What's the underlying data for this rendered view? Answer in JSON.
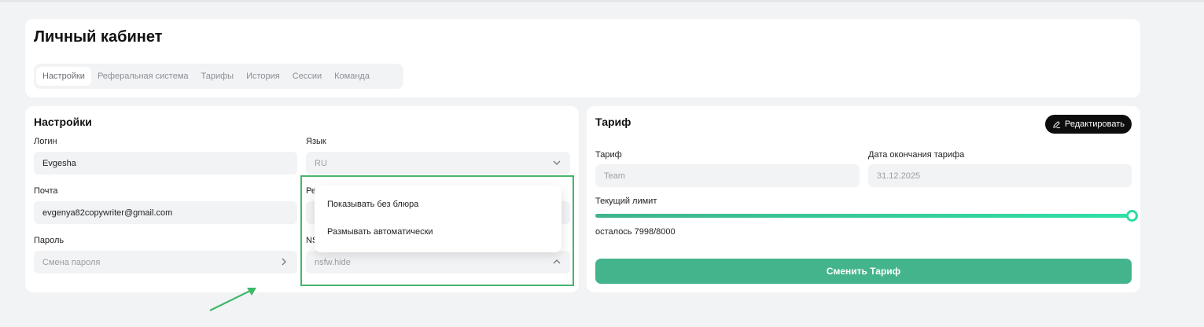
{
  "page": {
    "title": "Личный кабинет",
    "tabs": [
      {
        "label": "Настройки",
        "active": true
      },
      {
        "label": "Реферальная система",
        "active": false
      },
      {
        "label": "Тарифы",
        "active": false
      },
      {
        "label": "История",
        "active": false
      },
      {
        "label": "Сессии",
        "active": false
      },
      {
        "label": "Команда",
        "active": false
      }
    ]
  },
  "settings": {
    "title": "Настройки",
    "login": {
      "label": "Логин",
      "value": "Evgesha"
    },
    "language": {
      "label": "Язык",
      "value": "RU"
    },
    "email": {
      "label": "Почта",
      "value": "evgenya82copywriter@gmail.com"
    },
    "password": {
      "label": "Пароль",
      "placeholder": "Смена пароля"
    },
    "partial_label_1": "Ре",
    "partial_label_2": "NS",
    "nsfw": {
      "value": "nsfw.hide"
    },
    "dropdown_options": [
      "Показывать без блюра",
      "Размывать автоматически"
    ]
  },
  "tariff": {
    "title": "Тариф",
    "edit_label": "Редактировать",
    "plan": {
      "label": "Тариф",
      "value": "Team"
    },
    "end_date": {
      "label": "Дата окончания тарифа",
      "value": "31.12.2025"
    },
    "limit": {
      "label": "Текущий лимит",
      "remaining": 7998,
      "total": 8000,
      "remaining_text": "осталось 7998/8000"
    },
    "change_label": "Сменить Тариф"
  },
  "colors": {
    "accent": "#44b48d",
    "highlight": "#47b56d",
    "background": "#f2f3f5"
  }
}
